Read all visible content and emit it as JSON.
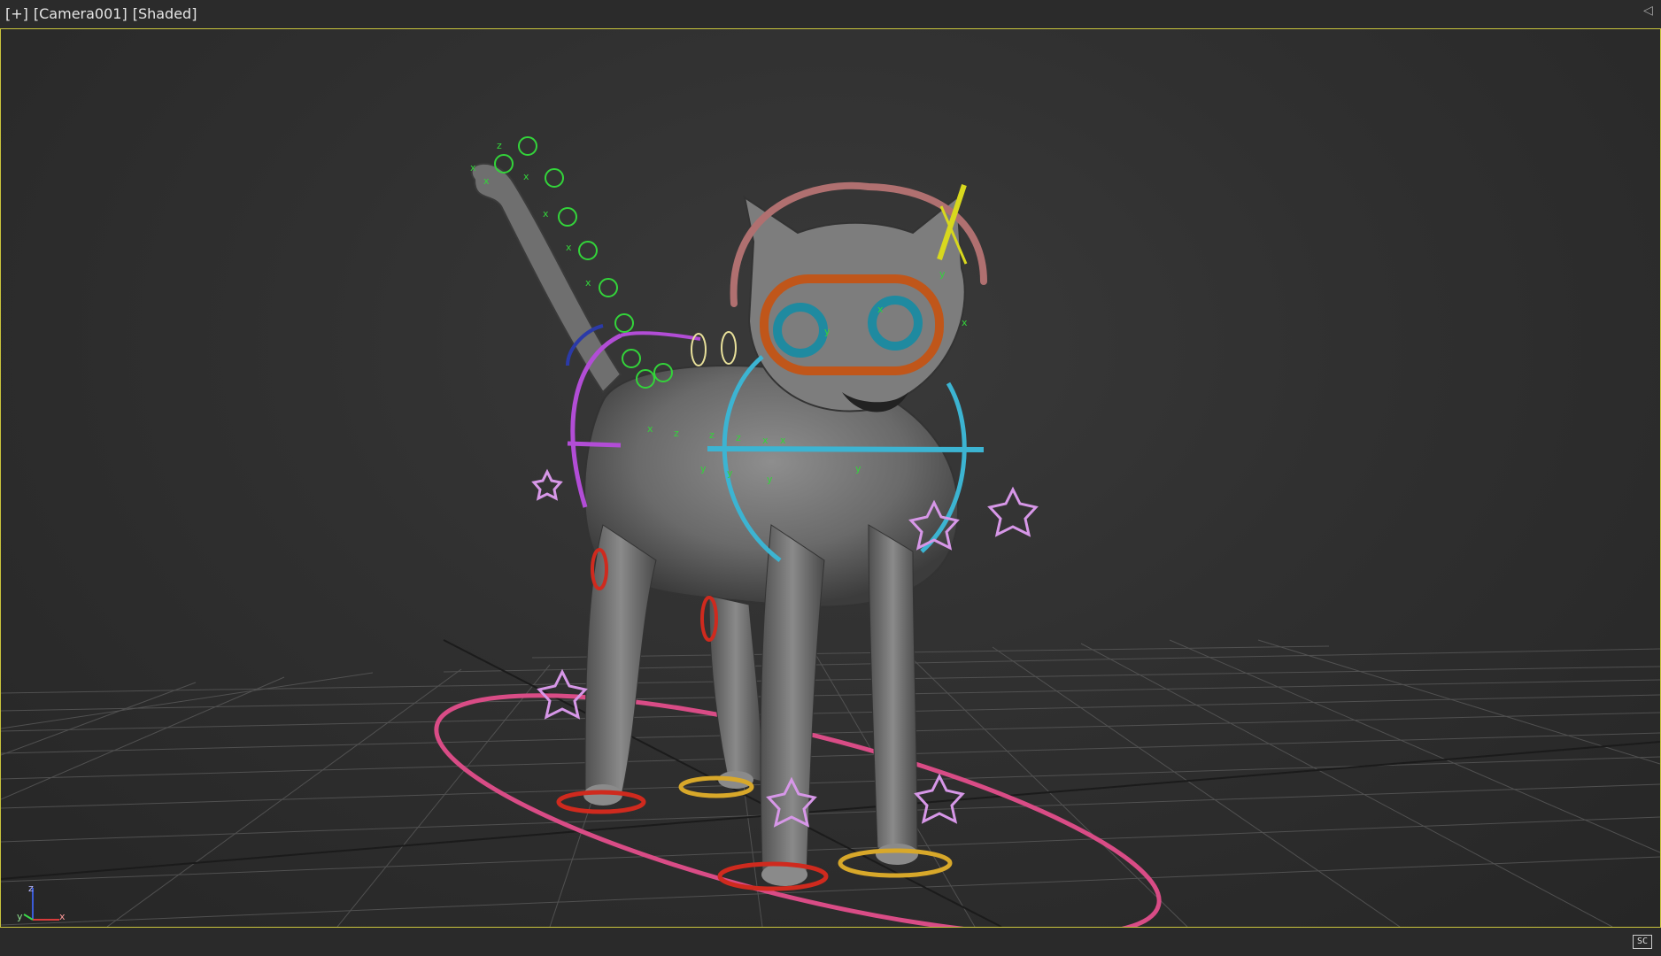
{
  "viewport": {
    "menu": {
      "plus": "[+]",
      "camera": "[Camera001]",
      "shading": "[Shaded]"
    },
    "axis_tripod": {
      "z": "z",
      "y": "y",
      "x": "x"
    },
    "corner_label": "SC"
  },
  "colors": {
    "active_border": "#c9c43c",
    "bone_helpers": "#33d43a",
    "spine_ring": "#b24dd6",
    "chest_ring": "#3cb4d2",
    "eye_frame": "#c0561a",
    "eye_rings": "#1f8aa0",
    "root_ellipse": "#d94c86",
    "front_feet": "#cf2a1e",
    "rear_feet": "#d8a82a",
    "star_controls": "#d797e8"
  },
  "icons": [
    "maximize-corner-icon",
    "safe-frame-icon",
    "axis-tripod-icon",
    "star-control-icon"
  ]
}
